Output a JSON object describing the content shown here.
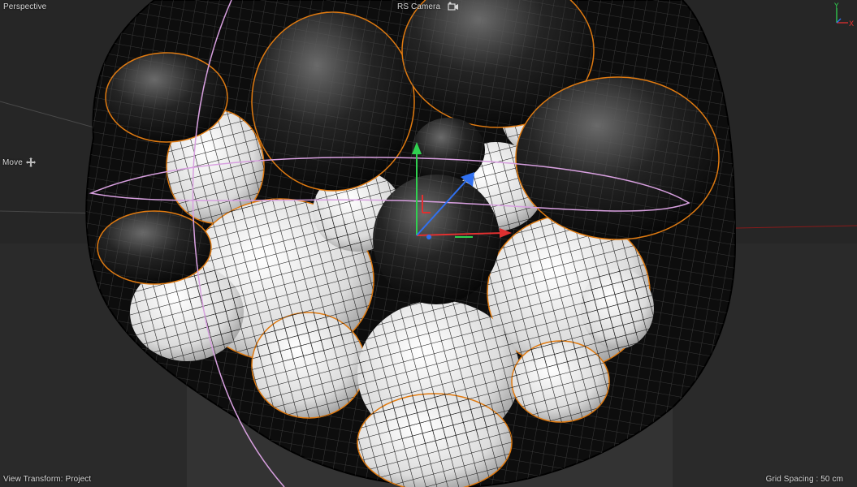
{
  "viewport": {
    "camera_mode": "Perspective",
    "active_camera": "RS Camera",
    "tool": "Move",
    "view_transform": "View Transform: Project",
    "grid_spacing": "Grid Spacing : 50 cm"
  },
  "axis_gizmo": {
    "y_label": "Y",
    "x_label": "X"
  },
  "icons": {
    "camera": "camera-icon",
    "move": "move-arrows-icon"
  },
  "colors": {
    "background": "#262626",
    "horizon_line": "#8a1a1a",
    "spline": "#d8a0e0",
    "selection_outline": "#e07a10",
    "axis_x": "#e03030",
    "axis_y": "#30d050",
    "axis_z": "#3070f0"
  }
}
